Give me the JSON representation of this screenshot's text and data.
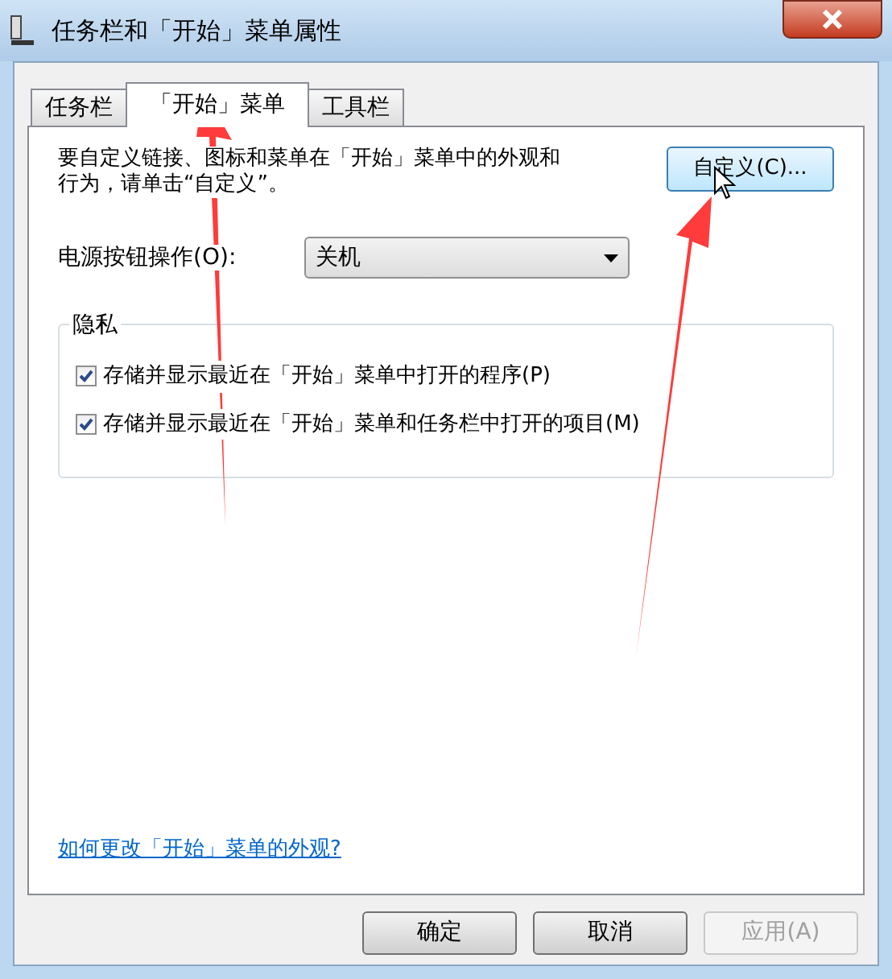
{
  "window": {
    "title": "任务栏和「开始」菜单属性"
  },
  "tabs": [
    {
      "label": "任务栏",
      "selected": false
    },
    {
      "label": "「开始」菜单",
      "selected": true
    },
    {
      "label": "工具栏",
      "selected": false
    }
  ],
  "description": "要自定义链接、图标和菜单在「开始」菜单中的外观和行为，请单击“自定义”。",
  "customize_button": "自定义(C)...",
  "power_button_action": {
    "label": "电源按钮操作(O):",
    "value": "关机"
  },
  "privacy": {
    "title": "隐私",
    "options": [
      {
        "label": "存储并显示最近在「开始」菜单中打开的程序(P)",
        "checked": true
      },
      {
        "label": "存储并显示最近在「开始」菜单和任务栏中打开的项目(M)",
        "checked": true
      }
    ]
  },
  "help_link": "如何更改「开始」菜单的外观?",
  "buttons": [
    {
      "label": "确定",
      "disabled": false
    },
    {
      "label": "取消",
      "disabled": false
    },
    {
      "label": "应用(A)",
      "disabled": true
    }
  ]
}
